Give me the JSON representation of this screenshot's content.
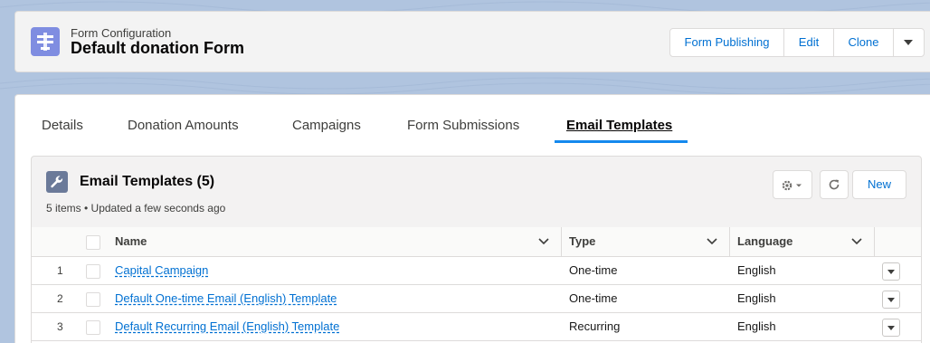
{
  "header": {
    "subtitle": "Form Configuration",
    "title": "Default donation Form",
    "icon": "form-icon",
    "buttons": {
      "publishing": "Form Publishing",
      "edit": "Edit",
      "clone": "Clone"
    }
  },
  "tabs": [
    {
      "label": "Details"
    },
    {
      "label": "Donation Amounts"
    },
    {
      "label": "Campaigns"
    },
    {
      "label": "Form Submissions"
    },
    {
      "label": "Email Templates",
      "active": true
    }
  ],
  "related_list": {
    "title": "Email Templates (5)",
    "meta": "5 items • Updated a few seconds ago",
    "new_label": "New",
    "columns": [
      "Name",
      "Type",
      "Language"
    ],
    "rows": [
      {
        "num": "1",
        "name": "Capital Campaign",
        "type": "One-time",
        "language": "English"
      },
      {
        "num": "2",
        "name": "Default One-time Email (English) Template",
        "type": "One-time",
        "language": "English"
      },
      {
        "num": "3",
        "name": "Default Recurring Email (English) Template",
        "type": "Recurring",
        "language": "English"
      }
    ]
  },
  "colors": {
    "brand_blue": "#0070d2",
    "tab_underline": "#1589ee",
    "header_icon_bg": "#7f8de1",
    "page_bg": "#b0c4df"
  }
}
